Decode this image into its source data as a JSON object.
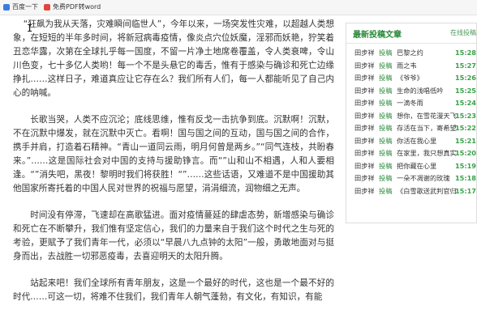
{
  "bookmarks": {
    "item1": "百度一下",
    "item2": "免费PDF转word"
  },
  "article": {
    "paragraphs": [
      "“狂飙为我从天落，灾难瞬间临世人”，今年以来，一场突发性灾难，以超越人类想象，在短短的半年多时间，将新冠病毒疫情，像炎点穴位妖魔，淫邪而妖艳，狞笑着丑恋华露，次第在全球扎乎每一国度，不留一片净土地席卷覆盖，令人类衰啤，令山川色变，七十多亿人类哟！每一个不是头悬它的毒舌，惟有于感染与确诊和死亡边缘挣扎……这样日子，难道真应让它存在么？我们所有人们，每一人都能听见了自己内心的呐喊。",
      "长歌当哭，人类不应沉沦；底线思维，惟有反戈一击抗争到底。沉默啊！沉默，不在沉默中爆发，就在沉默中灭亡。看啊！国与国之间的互动，国与国之间的合作，携手并肩，打造着石精神。“青山一道同云雨，明月何曾是两乡。”“同气连枝，共盼春来。”……这是国际社会对中国的支持与援助铮言。而“”山和山不相遇，人和人要相逢。“”消失吧，黑夜！黎明时我们将获胜！“”……这些话语，又难道不是中国援助其他国家所寄托着的中国人民对世界的祝福与愿望，涓涓细流，润物细之无声。",
      "时间没有停滞，飞速却在高歌猛进。面对疫情蔓延的肆虐态势，新增感染与确诊和死亡在不断攀升，我们惟有坚定信心，我们的力量来自于我们这个时代之生与死的考验，更赋予了我们青年一代，必须以“早晨八九点钟的太阳”一般，勇敢地面对与挺身而出，去战胜一切邪恶疫毒，去喜迎明天的太阳升腾。",
      "站起来吧！我们全球所有青年朋友，这是一个最好的时代，这也是一个最不好的时代……可这一切，将难不住我们，我们青年人朝气蓬勃，有文化，有知识，有能"
    ]
  },
  "sidebar": {
    "title": "最新投稿文章",
    "more_link": "在线投稿",
    "rows": [
      {
        "author": "田步祥",
        "cat": "投稿",
        "title": "巴黎之约",
        "time": "15:28"
      },
      {
        "author": "田步祥",
        "cat": "投稿",
        "title": "雨之韦",
        "time": "15:27"
      },
      {
        "author": "田步祥",
        "cat": "投稿",
        "title": "《爷爷》",
        "time": "15:26"
      },
      {
        "author": "田步祥",
        "cat": "投稿",
        "title": "生命的浅唱低吟",
        "time": "15:25"
      },
      {
        "author": "田步祥",
        "cat": "投稿",
        "title": "一滴冬雨",
        "time": "15:24"
      },
      {
        "author": "田步祥",
        "cat": "投稿",
        "title": "想你，在雪花漫天飞",
        "time": "15:23"
      },
      {
        "author": "田步祥",
        "cat": "投稿",
        "title": "存活在当下，寄希望",
        "time": "15:22"
      },
      {
        "author": "田步祥",
        "cat": "投稿",
        "title": "你活在我心里",
        "time": "15:21"
      },
      {
        "author": "田步祥",
        "cat": "投稿",
        "title": "在家里，我只想真实",
        "time": "15:20"
      },
      {
        "author": "田步祥",
        "cat": "投稿",
        "title": "把你藏在心里",
        "time": "15:19"
      },
      {
        "author": "田步祥",
        "cat": "投稿",
        "title": "一朵不凋谢的玫瑰",
        "time": "15:18"
      },
      {
        "author": "田步祥",
        "cat": "投稿",
        "title": "《白雪歌送武判官归",
        "time": "15:17"
      }
    ]
  },
  "colors": {
    "accent": "#2a8a3a",
    "time": "#3aa04a"
  }
}
